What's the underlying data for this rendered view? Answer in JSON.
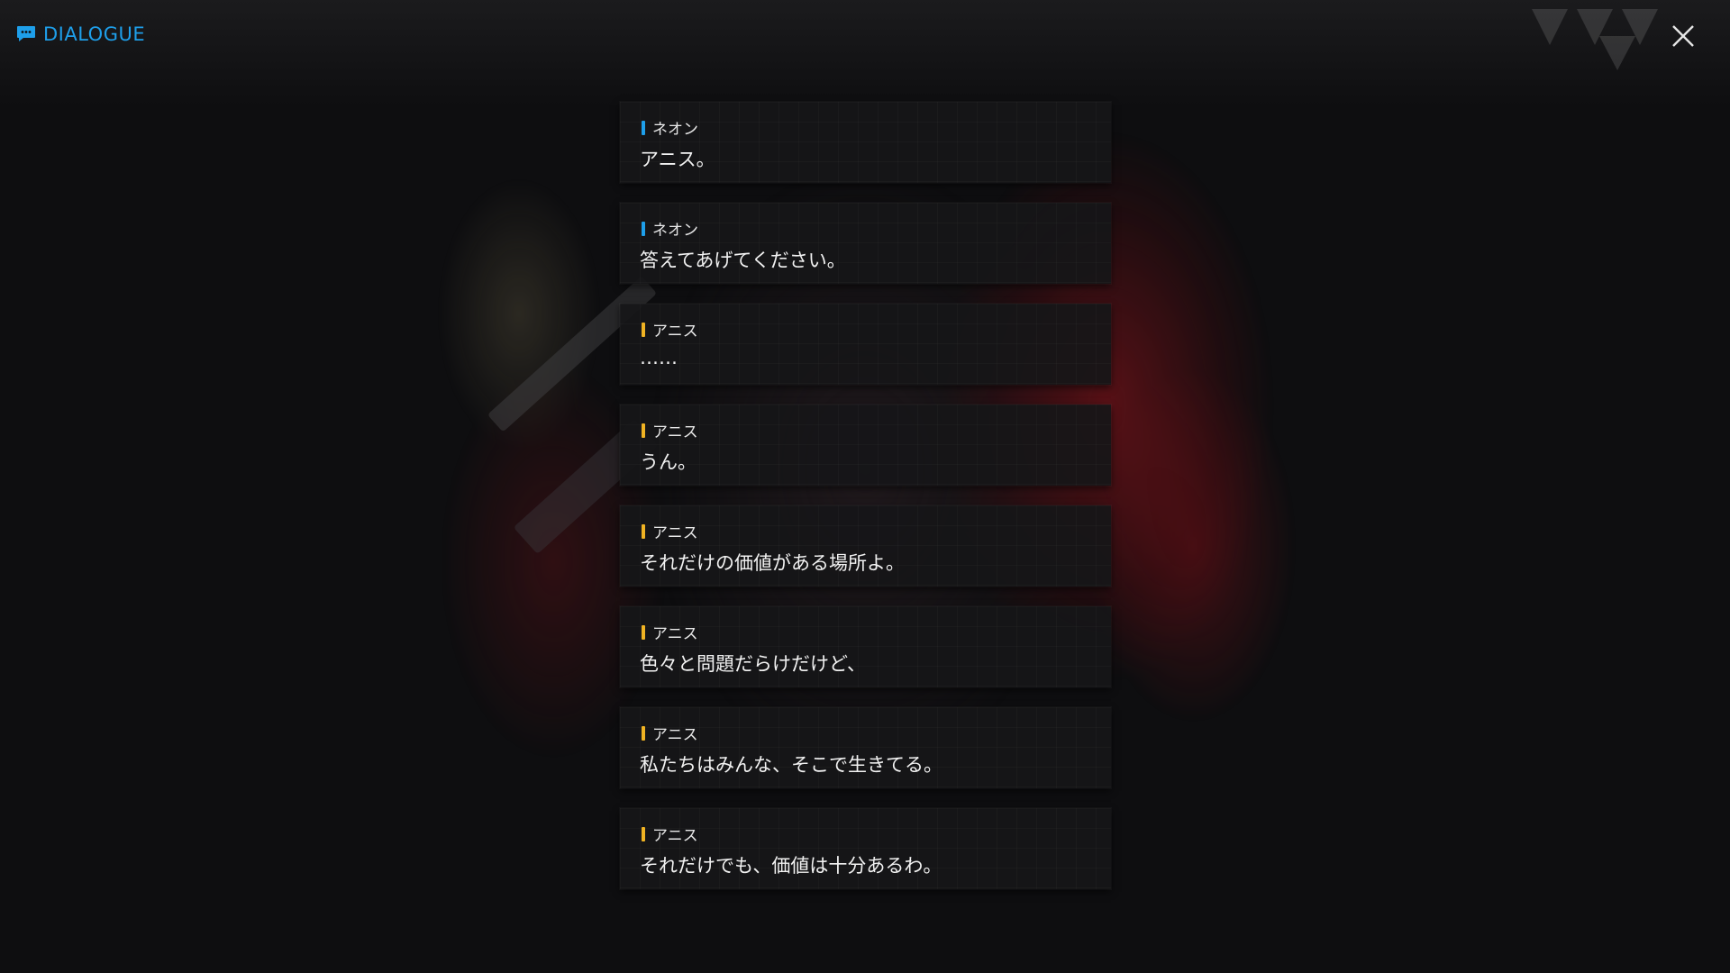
{
  "header": {
    "title": "DIALOGUE",
    "icon": "chat-bubble-icon",
    "accent_color": "#1e9fea"
  },
  "close_icon": "close-icon",
  "speaker_colors": {
    "neon": "#1e9fea",
    "anis": "#f0b323"
  },
  "entries": [
    {
      "speaker": "ネオン",
      "text": "アニス。",
      "color": "#1e9fea"
    },
    {
      "speaker": "ネオン",
      "text": "答えてあげてください。",
      "color": "#1e9fea"
    },
    {
      "speaker": "アニス",
      "text": "……",
      "color": "#f0b323"
    },
    {
      "speaker": "アニス",
      "text": "うん。",
      "color": "#f0b323"
    },
    {
      "speaker": "アニス",
      "text": "それだけの価値がある場所よ。",
      "color": "#f0b323"
    },
    {
      "speaker": "アニス",
      "text": "色々と問題だらけだけど、",
      "color": "#f0b323"
    },
    {
      "speaker": "アニス",
      "text": "私たちはみんな、そこで生きてる。",
      "color": "#f0b323"
    },
    {
      "speaker": "アニス",
      "text": "それだけでも、価値は十分あるわ。",
      "color": "#f0b323"
    }
  ]
}
